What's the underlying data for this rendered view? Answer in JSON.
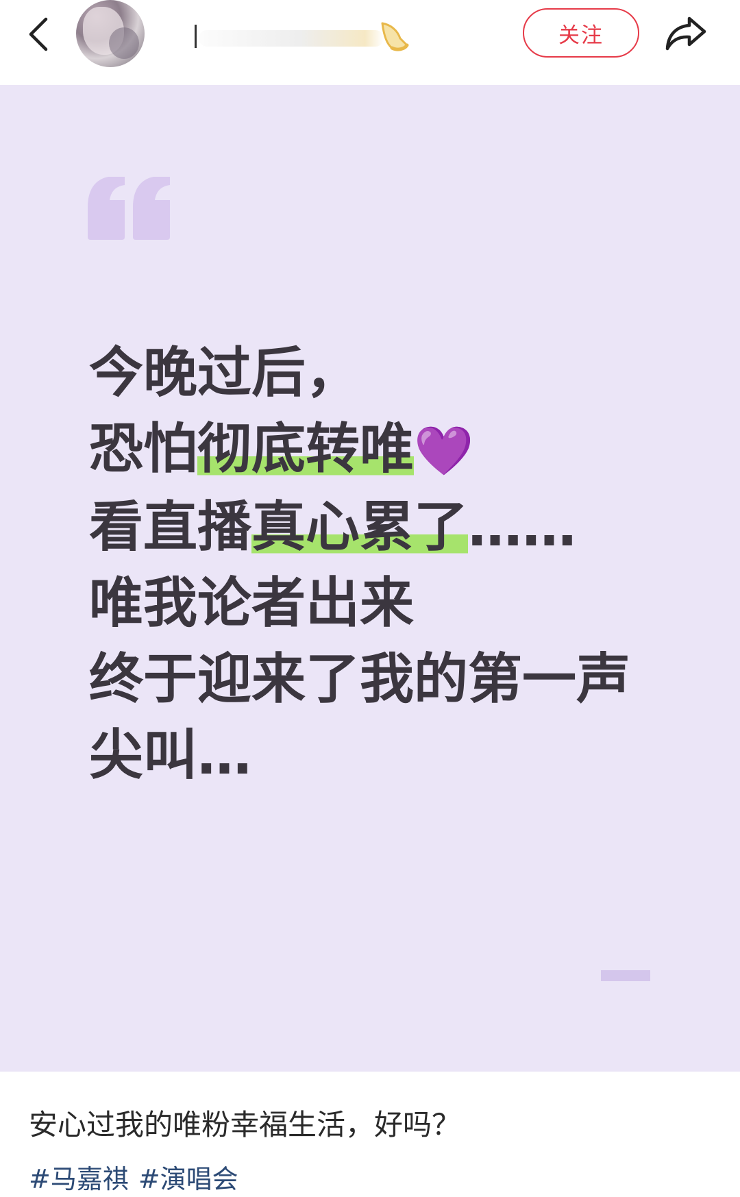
{
  "header": {
    "back_icon": "chevron-left-icon",
    "follow_label": "关注",
    "share_icon": "share-arrow-icon",
    "accent_color": "#e63a48"
  },
  "card": {
    "background": "#ebe5f7",
    "quote_icon": "quote-mark-icon",
    "lines": {
      "l1": "今晚过后，",
      "l2_pre": "恐怕",
      "l2_hl": "彻底转唯",
      "l2_emoji": "💜",
      "l3_pre": "看直播",
      "l3_hl": "真心累了",
      "l3_post": "……",
      "l4": "唯我论者出来",
      "l5": "终于迎来了我的第一声",
      "l6": "尖叫…"
    },
    "highlight_color": "#a6e36c"
  },
  "post": {
    "caption": "安心过我的唯粉幸福生活，好吗？",
    "tags": [
      "#马嘉祺",
      "#演唱会"
    ],
    "tag_color": "#2c4a75"
  }
}
